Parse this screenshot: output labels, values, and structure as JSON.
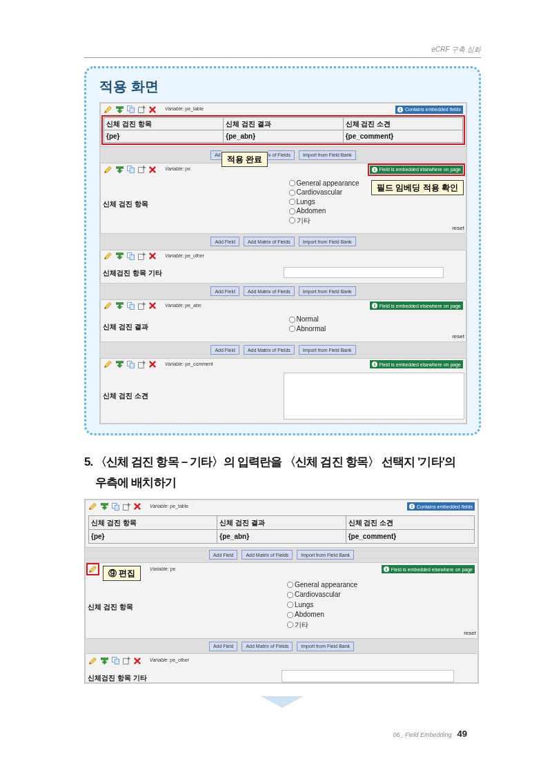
{
  "header": {
    "running_title": "eCRF 구축 심화"
  },
  "example": {
    "title": "적용 화면",
    "screen": {
      "items": [
        {
          "kind": "table_field",
          "variable": "*Variable:* pe_table",
          "edit_highlighted": false,
          "badge": {
            "kind": "contains",
            "label": "Contains embedded fields",
            "highlighted": false
          },
          "table_highlighted": true,
          "columns": [
            "신체 검진 항목",
            "신체 검진 결과",
            "신체 검진 소견"
          ],
          "rows": [
            [
              "{pe}",
              "{pe_abn}",
              "{pe_comment}"
            ]
          ]
        },
        {
          "kind": "buttons",
          "callout": "적용 완료",
          "buttons": [
            {
              "kind": "cut_end",
              "label": "Ad"
            },
            {
              "kind": "cut_start",
              "label": "k of Fields"
            },
            {
              "kind": "whole",
              "label": "Import from Field Bank"
            }
          ]
        },
        {
          "kind": "radio_field",
          "variable": "*Variable:* pe",
          "edit_highlighted": false,
          "badge": {
            "kind": "embedded",
            "label": "Field is embedded elsewhere on page",
            "highlighted": true
          },
          "callout": {
            "kind": "below_badge",
            "label": "필드 임베딩 적용 확인"
          },
          "label": "신체 검진 항목",
          "options": [
            {
              "label": "General appearance",
              "selected": false
            },
            {
              "label": "Cardiovascular",
              "selected": false
            },
            {
              "label": "Lungs",
              "selected": false
            },
            {
              "label": "Abdomen",
              "selected": false
            },
            {
              "label": "기타",
              "selected": false
            }
          ],
          "reset": "reset"
        },
        {
          "kind": "buttons",
          "buttons": [
            {
              "kind": "whole",
              "label": "Add Field"
            },
            {
              "kind": "whole",
              "label": "Add Matrix of Fields"
            },
            {
              "kind": "whole",
              "label": "Import from Field Bank"
            }
          ]
        },
        {
          "kind": "text_field",
          "variable": "*Variable:* pe_other",
          "edit_highlighted": false,
          "label": "신체검진 항목 기타"
        },
        {
          "kind": "buttons",
          "buttons": [
            {
              "kind": "whole",
              "label": "Add Field"
            },
            {
              "kind": "whole",
              "label": "Add Matrix of Fields"
            },
            {
              "kind": "whole",
              "label": "Import from Field Bank"
            }
          ]
        },
        {
          "kind": "radio_field",
          "variable": "*Variable:* pe_abn",
          "edit_highlighted": false,
          "badge": {
            "kind": "embedded",
            "label": "Field is embedded elsewhere on page",
            "highlighted": false
          },
          "label": "신체 검진 결과",
          "options": [
            {
              "label": "Normal",
              "selected": false
            },
            {
              "label": "Abnormal",
              "selected": false
            }
          ],
          "reset": "reset"
        },
        {
          "kind": "buttons",
          "buttons": [
            {
              "kind": "whole",
              "label": "Add Field"
            },
            {
              "kind": "whole",
              "label": "Add Matrix of Fields"
            },
            {
              "kind": "whole",
              "label": "Import from Field Bank"
            }
          ]
        },
        {
          "kind": "notes_field",
          "variable": "*Variable:* pe_comment",
          "edit_highlighted": false,
          "badge": {
            "kind": "embedded",
            "label": "Field is embedded elsewhere on page",
            "highlighted": false
          },
          "label": "신체 검진 소견"
        }
      ]
    }
  },
  "step": {
    "number": "5.",
    "text": "〈신체 검진 항목 – 기타〉의 입력란을 〈신체 검진 항목〉 선택지 '기타'의 우측에 배치하기"
  },
  "screen": {
    "items": [
      {
        "kind": "table_field",
        "variable": "*Variable:* pe_table",
        "edit_highlighted": false,
        "badge": {
          "kind": "contains",
          "label": "Contains embedded fields",
          "highlighted": false
        },
        "table_highlighted": false,
        "columns": [
          "신체 검진 항목",
          "신체 검진 결과",
          "신체 검진 소견"
        ],
        "rows": [
          [
            "{pe}",
            "{pe_abn}",
            "{pe_comment}"
          ]
        ]
      },
      {
        "kind": "buttons",
        "buttons": [
          {
            "kind": "whole",
            "label": "Add Field"
          },
          {
            "kind": "whole",
            "label": "Add Matrix of Fields"
          },
          {
            "kind": "whole",
            "label": "Import from Field Bank"
          }
        ]
      },
      {
        "kind": "radio_field",
        "variable": "*Variable:* pe",
        "edit_highlighted": true,
        "badge": {
          "kind": "embedded",
          "label": "Field is embedded elsewhere on page",
          "highlighted": false
        },
        "callout": {
          "kind": "over_tools",
          "label": "⑨ 편집"
        },
        "label": "신체 검진 항목",
        "options": [
          {
            "label": "General appearance",
            "selected": false
          },
          {
            "label": "Cardiovascular",
            "selected": false
          },
          {
            "label": "Lungs",
            "selected": false
          },
          {
            "label": "Abdomen",
            "selected": false
          },
          {
            "label": "기타",
            "selected": false
          }
        ],
        "reset": "reset"
      },
      {
        "kind": "buttons",
        "buttons": [
          {
            "kind": "whole",
            "label": "Add Field"
          },
          {
            "kind": "whole",
            "label": "Add Matrix of Fields"
          },
          {
            "kind": "whole",
            "label": "Import from Field Bank"
          }
        ]
      },
      {
        "kind": "text_field",
        "variable": "*Variable:* pe_other",
        "edit_highlighted": false,
        "label": "신체검진 항목 기타"
      }
    ]
  },
  "footer": {
    "chapter": "06_ Field Embedding",
    "page": "49"
  }
}
